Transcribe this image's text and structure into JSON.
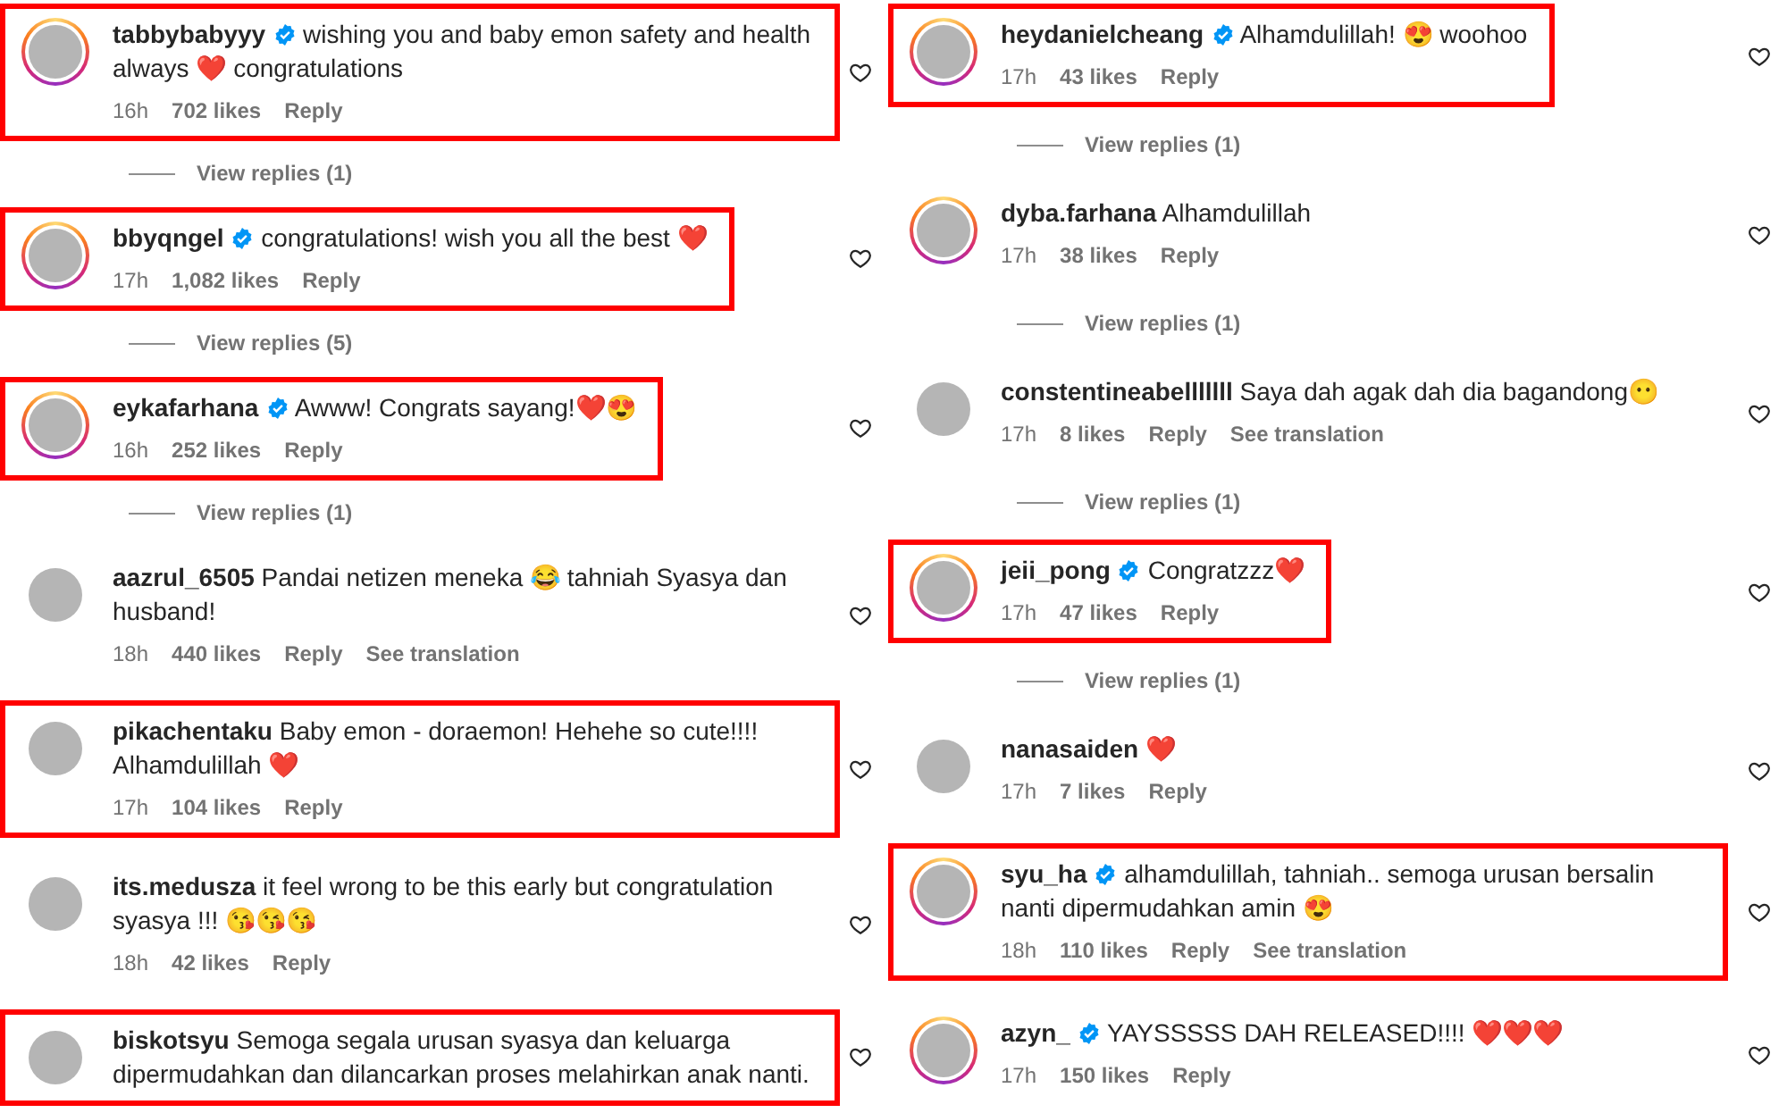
{
  "columns": [
    {
      "entries": [
        {
          "kind": "comment",
          "username": "tabbybabyyy",
          "verified": true,
          "has_story": true,
          "highlighted": true,
          "text": "wishing you and baby emon safety and health always ❤️ congratulations",
          "time": "16h",
          "likes": "702 likes",
          "reply": "Reply"
        },
        {
          "kind": "view_replies",
          "label": "View replies (1)"
        },
        {
          "kind": "comment",
          "username": "bbyqngel",
          "verified": true,
          "has_story": true,
          "highlighted": true,
          "text": "congratulations! wish you all the best ❤️",
          "time": "17h",
          "likes": "1,082 likes",
          "reply": "Reply"
        },
        {
          "kind": "view_replies",
          "label": "View replies (5)"
        },
        {
          "kind": "comment",
          "username": "eykafarhana",
          "verified": true,
          "has_story": true,
          "highlighted": true,
          "text": "Awww! Congrats sayang!❤️😍",
          "time": "16h",
          "likes": "252 likes",
          "reply": "Reply"
        },
        {
          "kind": "view_replies",
          "label": "View replies (1)"
        },
        {
          "kind": "comment",
          "username": "aazrul_6505",
          "verified": false,
          "has_story": false,
          "highlighted": false,
          "text": "Pandai netizen meneka 😂 tahniah Syasya dan husband!",
          "time": "18h",
          "likes": "440 likes",
          "reply": "Reply",
          "translation": "See translation"
        },
        {
          "kind": "comment",
          "username": "pikachentaku",
          "verified": false,
          "has_story": false,
          "highlighted": true,
          "text": "Baby emon - doraemon! Hehehe so cute!!!! Alhamdulillah ❤️",
          "time": "17h",
          "likes": "104 likes",
          "reply": "Reply"
        },
        {
          "kind": "comment",
          "username": "its.medusza",
          "verified": false,
          "has_story": false,
          "highlighted": false,
          "text": "it feel wrong to be this early but congratulation syasya !!! 😘😘😘",
          "time": "18h",
          "likes": "42 likes",
          "reply": "Reply"
        },
        {
          "kind": "comment",
          "username": "biskotsyu",
          "verified": false,
          "has_story": false,
          "highlighted": true,
          "text": "Semoga segala urusan syasya dan keluarga dipermudahkan dan dilancarkan proses melahirkan anak nanti."
        }
      ]
    },
    {
      "entries": [
        {
          "kind": "comment",
          "username": "heydanielcheang",
          "verified": true,
          "has_story": true,
          "highlighted": true,
          "text": "Alhamdulillah! 😍 woohoo",
          "time": "17h",
          "likes": "43 likes",
          "reply": "Reply"
        },
        {
          "kind": "view_replies",
          "label": "View replies (1)"
        },
        {
          "kind": "comment",
          "username": "dyba.farhana",
          "verified": false,
          "has_story": true,
          "highlighted": false,
          "text": "Alhamdulillah",
          "time": "17h",
          "likes": "38 likes",
          "reply": "Reply"
        },
        {
          "kind": "view_replies",
          "label": "View replies (1)"
        },
        {
          "kind": "comment",
          "username": "constentineabelllllll",
          "verified": false,
          "has_story": false,
          "highlighted": false,
          "text": "Saya dah agak dah dia bagandong😶",
          "time": "17h",
          "likes": "8 likes",
          "reply": "Reply",
          "translation": "See translation"
        },
        {
          "kind": "view_replies",
          "label": "View replies (1)"
        },
        {
          "kind": "comment",
          "username": "jeii_pong",
          "verified": true,
          "has_story": true,
          "highlighted": true,
          "text": "Congratzzz❤️",
          "time": "17h",
          "likes": "47 likes",
          "reply": "Reply"
        },
        {
          "kind": "view_replies",
          "label": "View replies (1)"
        },
        {
          "kind": "comment",
          "username": "nanasaiden",
          "verified": false,
          "has_story": false,
          "highlighted": false,
          "text": "❤️",
          "time": "17h",
          "likes": "7 likes",
          "reply": "Reply"
        },
        {
          "kind": "comment",
          "username": "syu_ha",
          "verified": true,
          "has_story": true,
          "highlighted": true,
          "text": "alhamdulillah, tahniah.. semoga urusan bersalin nanti dipermudahkan amin 😍",
          "time": "18h",
          "likes": "110 likes",
          "reply": "Reply",
          "translation": "See translation"
        },
        {
          "kind": "comment",
          "username": "azyn_",
          "verified": true,
          "has_story": true,
          "highlighted": false,
          "text": "YAYSSSSS DAH RELEASED!!!! ❤️❤️❤️",
          "time": "17h",
          "likes": "150 likes",
          "reply": "Reply"
        }
      ]
    }
  ]
}
